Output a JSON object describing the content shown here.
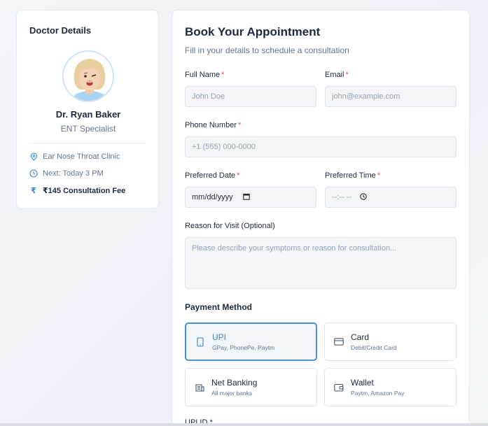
{
  "doctor": {
    "section_title": "Doctor Details",
    "name": "Dr. Ryan Baker",
    "specialty": "ENT Specialist",
    "clinic": "Ear Nose Throat Clinic",
    "availability": "Next: Today 3 PM",
    "fee": "₹145 Consultation Fee"
  },
  "form": {
    "title": "Book Your Appointment",
    "subtitle": "Fill in your details to schedule a consultation",
    "full_name": {
      "label": "Full Name",
      "placeholder": "John Doe"
    },
    "email": {
      "label": "Email",
      "placeholder": "john@example.com"
    },
    "phone": {
      "label": "Phone Number",
      "placeholder": "+1 (555) 000-0000"
    },
    "date": {
      "label": "Preferred Date",
      "value": "mm/dd/yyyy"
    },
    "time": {
      "label": "Preferred Time",
      "value": "--:-- --"
    },
    "reason": {
      "label": "Reason for Visit (Optional)",
      "placeholder": "Please describe your symptoms or reason for consultation..."
    },
    "required_marker": "*"
  },
  "payment": {
    "title": "Payment Method",
    "options": [
      {
        "label": "UPI",
        "sub": "GPay, PhonePe, Paytm",
        "icon": "phone-icon",
        "selected": true
      },
      {
        "label": "Card",
        "sub": "Debit/Credit Card",
        "icon": "card-icon",
        "selected": false
      },
      {
        "label": "Net Banking",
        "sub": "All major banks",
        "icon": "bank-icon",
        "selected": false
      },
      {
        "label": "Wallet",
        "sub": "Paytm, Amazon Pay",
        "icon": "wallet-icon",
        "selected": false
      }
    ],
    "next_label_cut": "UPI ID *"
  },
  "colors": {
    "accent": "#3b82c4",
    "required": "#ef4444"
  }
}
